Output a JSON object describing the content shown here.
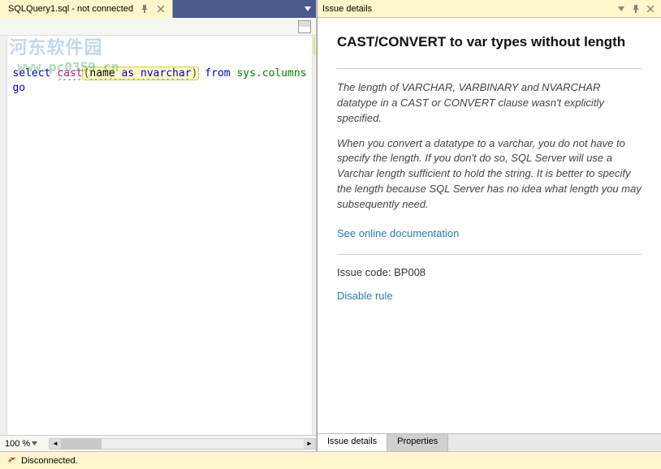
{
  "editor": {
    "tab_title": "SQLQuery1.sql - not connected",
    "code": {
      "line1": {
        "kw_select": "select",
        "kw_cast": "cast",
        "paren_open": "(",
        "arg_name": "name ",
        "kw_as": "as",
        "arg_type": " nvarchar",
        "paren_close": ")",
        "kw_from": "from",
        "ident": "sys.columns"
      },
      "line2": "go"
    },
    "zoom": "100 %"
  },
  "issue": {
    "panel_title": "Issue details",
    "title": "CAST/CONVERT to var types without length",
    "para1": "The length of VARCHAR, VARBINARY and NVARCHAR datatype in a CAST or CONVERT clause wasn't explicitly specified.",
    "para2": "When you convert a datatype to a varchar, you do not have to specify the length. If you don't do so, SQL Server will use a Varchar length sufficient to hold the string. It is better to specify the length because SQL Server has no idea what length you may subsequently need.",
    "doc_link": "See online documentation",
    "code_label": "Issue code:",
    "code_value": "BP008",
    "disable_link": "Disable rule",
    "tabs": {
      "details": "Issue details",
      "properties": "Properties"
    }
  },
  "status": {
    "text": "Disconnected."
  },
  "watermark": {
    "text": "河东软件园",
    "url": "www.pc0359.cn"
  }
}
